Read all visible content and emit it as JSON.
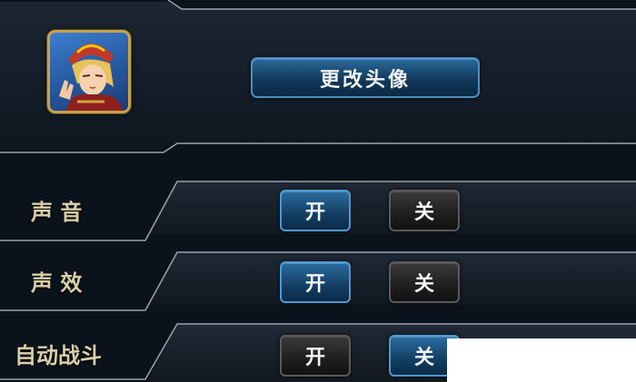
{
  "profile": {
    "avatar_icon": "hero-avatar-icon",
    "change_avatar_label": "更改头像"
  },
  "settings": [
    {
      "label": "声 音",
      "on_label": "开",
      "off_label": "关",
      "selected": "on"
    },
    {
      "label": "声 效",
      "on_label": "开",
      "off_label": "关",
      "selected": "on"
    },
    {
      "label": "自动战斗",
      "on_label": "开",
      "off_label": "关",
      "selected": "off"
    }
  ],
  "colors": {
    "selected": "#1c4f7a",
    "unselected": "#1e1e1e",
    "label": "#d9cfa8",
    "frame": "#c9a24a"
  }
}
